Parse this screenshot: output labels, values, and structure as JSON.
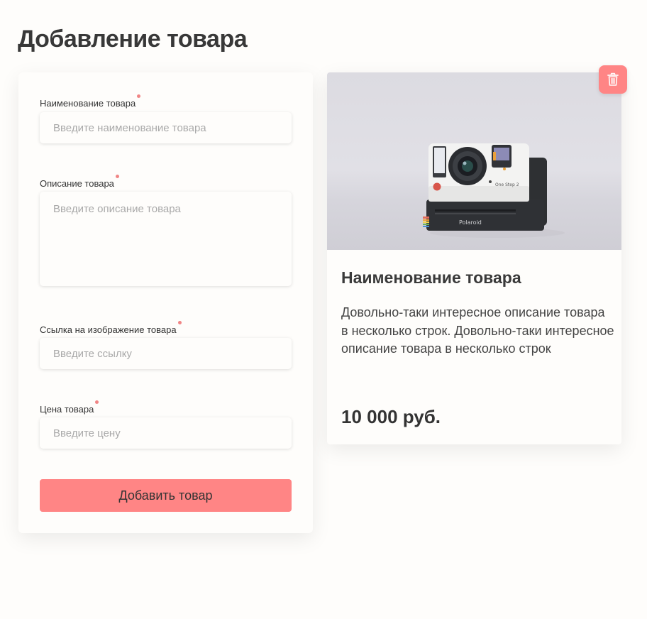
{
  "page": {
    "title": "Добавление товара"
  },
  "form": {
    "name_label": "Наименование товара",
    "name_placeholder": "Введите наименование товара",
    "description_label": "Описание товара",
    "description_placeholder": "Введите описание товара",
    "image_label": "Ссылка на изображение товара",
    "image_placeholder": "Введите ссылку",
    "price_label": "Цена товара",
    "price_placeholder": "Введите цену",
    "submit_label": "Добавить товар"
  },
  "product": {
    "name": "Наименование товара",
    "description": "Довольно-таки интересное описание товара в несколько строк. Довольно-таки интересное описание товара в несколько строк",
    "price": "10 000 руб.",
    "camera_brand": "Polaroid",
    "camera_model": "One Step 2",
    "delete_icon": "trash-icon"
  },
  "colors": {
    "accent": "#ff8585",
    "required_dot": "#f08585",
    "background": "#fefdfb",
    "text": "#3b3b3b",
    "placeholder": "#a9a9a9"
  }
}
